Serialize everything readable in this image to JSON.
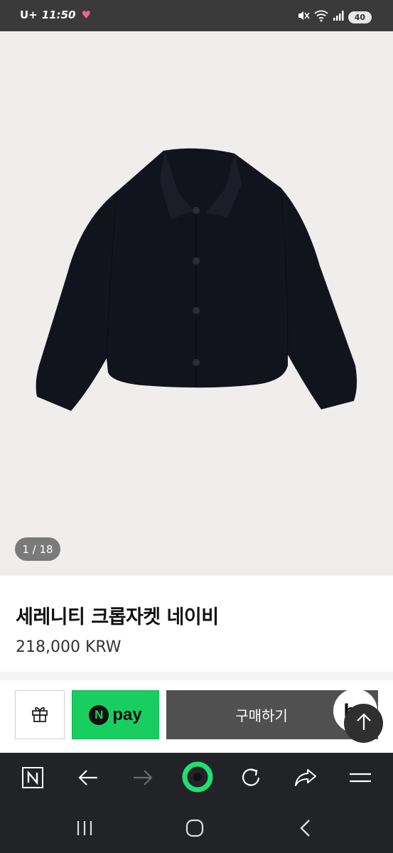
{
  "status_bar": {
    "carrier": "U+",
    "time": "11:50",
    "battery": "40"
  },
  "hero": {
    "image_alt": "navy cropped jacket",
    "page_counter": "1 / 18",
    "colors": {
      "background": "#efeeec",
      "jacket": "#12141d",
      "lining": "#6f7f95"
    }
  },
  "product": {
    "title": "세레니티 크롭자켓 네이비",
    "price": "218,000 KRW"
  },
  "purchase": {
    "gift_icon": "gift-icon",
    "npay_badge": "N",
    "npay_label": "pay",
    "buy_label": "구매하기",
    "chat_label": "he",
    "scroll_top_icon": "arrow-up-icon",
    "colors": {
      "npay": "#19ce60",
      "buy": "#505050"
    }
  },
  "browser_toolbar": {
    "items": [
      "naver-home-icon",
      "back-arrow-icon",
      "forward-arrow-icon",
      "green-dot-icon",
      "refresh-icon",
      "share-icon",
      "menu-icon"
    ]
  },
  "nav_bar": {
    "items": [
      "recent-apps-icon",
      "home-icon",
      "back-icon"
    ]
  }
}
